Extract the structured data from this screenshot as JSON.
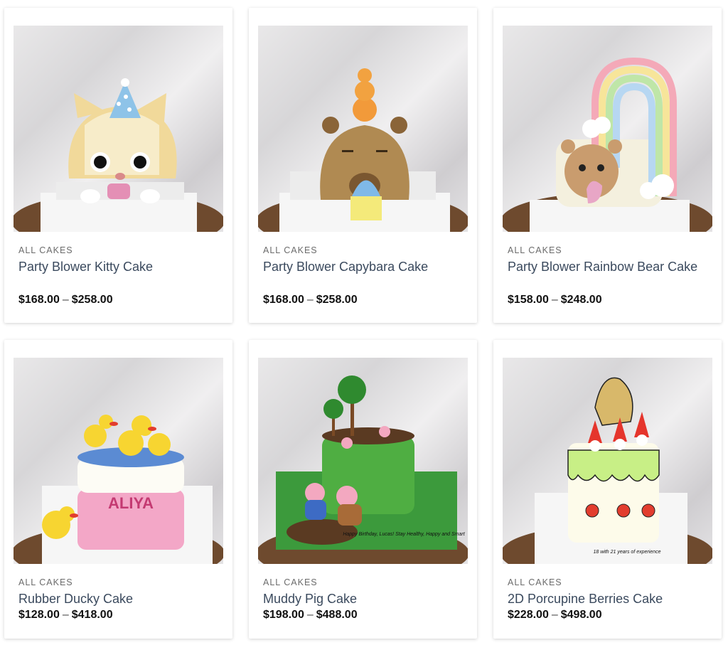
{
  "products": [
    {
      "category": "ALL CAKES",
      "name": "Party Blower Kitty Cake",
      "price_min": "$168.00",
      "price_sep": "–",
      "price_max": "$258.00"
    },
    {
      "category": "ALL CAKES",
      "name": "Party Blower Capybara Cake",
      "price_min": "$168.00",
      "price_sep": "–",
      "price_max": "$258.00"
    },
    {
      "category": "ALL CAKES",
      "name": "Party Blower Rainbow Bear Cake",
      "price_min": "$158.00",
      "price_sep": "–",
      "price_max": "$248.00"
    },
    {
      "category": "ALL CAKES",
      "name": "Rubber Ducky Cake",
      "price_min": "$128.00",
      "price_sep": "–",
      "price_max": "$418.00",
      "cake_text": "ALIYA"
    },
    {
      "category": "ALL CAKES",
      "name": "Muddy Pig Cake",
      "price_min": "$198.00",
      "price_sep": "–",
      "price_max": "$488.00",
      "cake_text": "Happy Birthday, Lucas! Stay Healthy, Happy and Smart"
    },
    {
      "category": "ALL CAKES",
      "name": "2D Porcupine Berries Cake",
      "price_min": "$228.00",
      "price_sep": "–",
      "price_max": "$498.00",
      "cake_text": "18 with 21 years of experience"
    }
  ]
}
